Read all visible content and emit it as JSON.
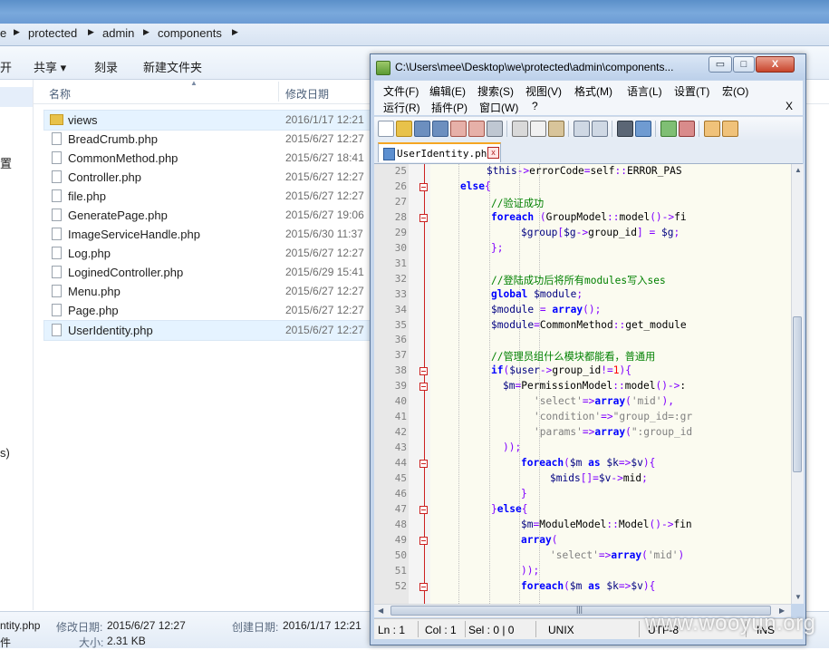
{
  "explorer": {
    "breadcrumb": [
      "e",
      "protected",
      "admin",
      "components"
    ],
    "toolbar": {
      "open": "开",
      "share": "共享 ▾",
      "burn": "刻录",
      "new_folder": "新建文件夹"
    },
    "nav_items": [
      "置",
      "s)"
    ],
    "columns": {
      "name": "名称",
      "modified": "修改日期"
    },
    "files": [
      {
        "name": "views",
        "date": "2016/1/17 12:21",
        "type": "folder"
      },
      {
        "name": "BreadCrumb.php",
        "date": "2015/6/27 12:27",
        "type": "file"
      },
      {
        "name": "CommonMethod.php",
        "date": "2015/6/27 18:41",
        "type": "file"
      },
      {
        "name": "Controller.php",
        "date": "2015/6/27 12:27",
        "type": "file"
      },
      {
        "name": "file.php",
        "date": "2015/6/27 12:27",
        "type": "file"
      },
      {
        "name": "GeneratePage.php",
        "date": "2015/6/27 19:06",
        "type": "file"
      },
      {
        "name": "ImageServiceHandle.php",
        "date": "2015/6/30 11:37",
        "type": "file"
      },
      {
        "name": "Log.php",
        "date": "2015/6/27 12:27",
        "type": "file"
      },
      {
        "name": "LoginedController.php",
        "date": "2015/6/29 15:41",
        "type": "file"
      },
      {
        "name": "Menu.php",
        "date": "2015/6/27 12:27",
        "type": "file"
      },
      {
        "name": "Page.php",
        "date": "2015/6/27 12:27",
        "type": "file"
      },
      {
        "name": "UserIdentity.php",
        "date": "2015/6/27 12:27",
        "type": "file"
      }
    ],
    "details": {
      "filename": "ntity.php",
      "modified_label": "修改日期:",
      "modified_value": "2015/6/27 12:27",
      "created_label": "创建日期:",
      "created_value": "2016/1/17 12:21",
      "size_label": "大小:",
      "size_value": "2.31 KB",
      "extra": "件"
    }
  },
  "notepad": {
    "title": "C:\\Users\\mee\\Desktop\\we\\protected\\admin\\components...",
    "window_buttons": {
      "minimize": "▭",
      "maximize": "□",
      "close": "X"
    },
    "menu_row1": [
      "文件(F)",
      "编辑(E)",
      "搜索(S)",
      "视图(V)",
      "格式(M)",
      "语言(L)",
      "设置(T)",
      "宏(O)"
    ],
    "menu_row2": [
      "运行(R)",
      "插件(P)",
      "窗口(W)",
      "?"
    ],
    "menu_close": "X",
    "tab": "UserIdentity.php",
    "tab_close": "x",
    "code_lines": [
      {
        "n": "25",
        "html": "<span class='var'>$this</span><span class='op'>-&gt;</span><span class='cls'>errorCode</span><span class='op'>=</span><span class='cls'>self</span><span class='op'>::</span><span class='cls'>ERROR_PAS</span>"
      },
      {
        "n": "26",
        "html": "<span class='kw'>else</span><span class='op'>{</span>"
      },
      {
        "n": "27",
        "html": "<span class='cmt'>//验证成功</span>"
      },
      {
        "n": "28",
        "html": "<span class='kw'>foreach</span> <span class='op'>(</span><span class='cls'>GroupModel</span><span class='op'>::</span><span class='fn'>model</span><span class='op'>()-&gt;</span><span class='cls'>fi</span>"
      },
      {
        "n": "29",
        "html": "<span class='var'>$group</span><span class='op'>[</span><span class='var'>$g</span><span class='op'>-&gt;</span><span class='cls'>group_id</span><span class='op'>]</span> <span class='op'>=</span> <span class='var'>$g</span><span class='op'>;</span>"
      },
      {
        "n": "30",
        "html": "<span class='op'>};</span>"
      },
      {
        "n": "31",
        "html": ""
      },
      {
        "n": "32",
        "html": "<span class='cmt'>//登陆成功后将所有modules写入ses</span>"
      },
      {
        "n": "33",
        "html": "<span class='kw'>global</span> <span class='var'>$module</span><span class='op'>;</span>"
      },
      {
        "n": "34",
        "html": "<span class='var'>$module</span> <span class='op'>=</span> <span class='kw'>array</span><span class='op'>();</span>"
      },
      {
        "n": "35",
        "html": "<span class='var'>$module</span><span class='op'>=</span><span class='cls'>CommonMethod</span><span class='op'>::</span><span class='fn'>get_module</span>"
      },
      {
        "n": "36",
        "html": ""
      },
      {
        "n": "37",
        "html": "<span class='cmt'>//管理员组什么模块都能看，普通用</span>"
      },
      {
        "n": "38",
        "html": "<span class='kw'>if</span><span class='op'>(</span><span class='var'>$user</span><span class='op'>-&gt;</span><span class='cls'>group_id</span><span class='op'>!=</span><span class='num'>1</span><span class='op'>){</span>"
      },
      {
        "n": "39",
        "html": "<span class='var'>$m</span><span class='op'>=</span><span class='cls'>PermissionModel</span><span class='op'>::</span><span class='fn'>model</span><span class='op'>()-&gt;</span><span class='cls'>:</span>"
      },
      {
        "n": "40",
        "html": "<span class='str'>'select'</span><span class='op'>=&gt;</span><span class='kw'>array</span><span class='op'>(</span><span class='str'>'mid'</span><span class='op'>),</span>"
      },
      {
        "n": "41",
        "html": "<span class='str'>'condition'</span><span class='op'>=&gt;</span><span class='str'>\"group_id=:gr</span>"
      },
      {
        "n": "42",
        "html": "<span class='str'>'params'</span><span class='op'>=&gt;</span><span class='kw'>array</span><span class='op'>(</span><span class='str'>\":group_id</span>"
      },
      {
        "n": "43",
        "html": "<span class='op'>));</span>"
      },
      {
        "n": "44",
        "html": "<span class='kw'>foreach</span><span class='op'>(</span><span class='var'>$m</span> <span class='kw'>as</span> <span class='var'>$k</span><span class='op'>=&gt;</span><span class='var'>$v</span><span class='op'>){</span>"
      },
      {
        "n": "45",
        "html": "<span class='var'>$mids</span><span class='op'>[]=</span><span class='var'>$v</span><span class='op'>-&gt;</span><span class='cls'>mid</span><span class='op'>;</span>"
      },
      {
        "n": "46",
        "html": "<span class='op'>}</span>"
      },
      {
        "n": "47",
        "html": "<span class='op'>}</span><span class='kw'>else</span><span class='op'>{</span>"
      },
      {
        "n": "48",
        "html": "<span class='var'>$m</span><span class='op'>=</span><span class='cls'>ModuleModel</span><span class='op'>::</span><span class='fn'>Model</span><span class='op'>()-&gt;</span><span class='cls'>fin</span>"
      },
      {
        "n": "49",
        "html": "<span class='kw'>array</span><span class='op'>(</span>"
      },
      {
        "n": "50",
        "html": "<span class='str'>'select'</span><span class='op'>=&gt;</span><span class='kw'>array</span><span class='op'>(</span><span class='str'>'mid'</span><span class='op'>)</span>"
      },
      {
        "n": "51",
        "html": "<span class='op'>));</span>"
      },
      {
        "n": "52",
        "html": "<span class='kw'>foreach</span><span class='op'>(</span><span class='var'>$m</span> <span class='kw'>as</span> <span class='var'>$k</span><span class='op'>=&gt;</span><span class='var'>$v</span><span class='op'>){</span>"
      }
    ],
    "status": {
      "ln": "Ln : 1",
      "col": "Col : 1",
      "sel": "Sel : 0 | 0",
      "eol": "UNIX",
      "enc": "UTF-8",
      "mode": "INS"
    }
  },
  "watermark": "www.wooyun.org"
}
